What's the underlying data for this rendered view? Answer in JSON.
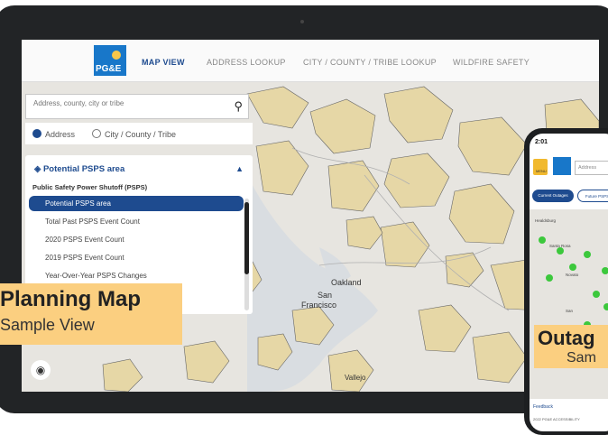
{
  "nav": {
    "logo_text": "PG&E",
    "items": [
      {
        "label": "MAP VIEW",
        "active": true
      },
      {
        "label": "ADDRESS LOOKUP",
        "active": false
      },
      {
        "label": "CITY / COUNTY / TRIBE LOOKUP",
        "active": false
      },
      {
        "label": "WILDFIRE SAFETY",
        "active": false
      }
    ]
  },
  "search": {
    "placeholder": "Address, county, city or tribe",
    "icon": "search-icon"
  },
  "search_mode": {
    "options": [
      {
        "label": "Address",
        "selected": true
      },
      {
        "label": "City / County / Tribe",
        "selected": false
      }
    ]
  },
  "layers_panel": {
    "title": "Potential PSPS area",
    "section": "Public Safety Power Shutoff (PSPS)",
    "items": [
      {
        "label": "Potential PSPS area",
        "active": true
      },
      {
        "label": "Total Past PSPS Event Count",
        "active": false
      },
      {
        "label": "2020 PSPS Event Count",
        "active": false
      },
      {
        "label": "2019 PSPS Event Count",
        "active": false
      },
      {
        "label": "Year-Over-Year PSPS Changes",
        "active": false
      }
    ]
  },
  "map_labels": {
    "oakland": "Oakland",
    "san_francisco_1": "San",
    "san_francisco_2": "Francisco",
    "vallejo": "Vallejo"
  },
  "captions": {
    "planning_title": "Planning Map",
    "planning_sub": "Sample View",
    "outage_title": "Outag",
    "outage_sub": "Sam"
  },
  "phone": {
    "time": "2:01",
    "menu_label": "MENU",
    "address_placeholder": "Address",
    "tab_current": "Current Outages",
    "tab_future": "Future PSPS",
    "map_labels": [
      "Healdsburg",
      "Santa Rosa",
      "Novato",
      "San"
    ],
    "feedback": "Feedback",
    "footer": "2022 PG&E    ACCESSIBILITY"
  },
  "colors": {
    "brand_blue": "#1e4b8f",
    "accent_orange": "#fbcf80",
    "psps_fill": "#e6d7a6",
    "outage_green": "#3cc83c"
  }
}
